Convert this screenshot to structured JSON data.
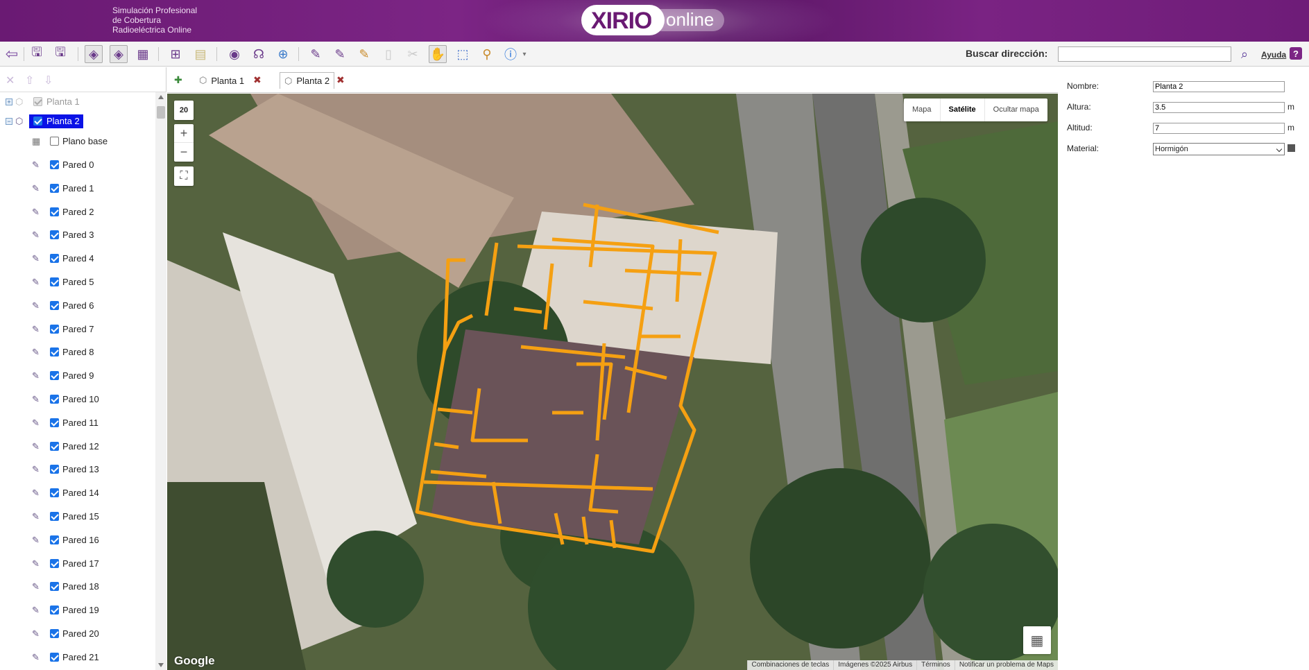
{
  "header": {
    "tagline": [
      "Simulación Profesional",
      "de Cobertura",
      "Radioeléctrica Online"
    ],
    "logo_main": "XIRIO",
    "logo_sub": "online"
  },
  "toolbar": {
    "search_label": "Buscar dirección:",
    "search_value": "",
    "help_label": "Ayuda",
    "help_icon": "?"
  },
  "tabs": [
    {
      "label": "Planta 1",
      "active": false
    },
    {
      "label": "Planta 2",
      "active": true
    }
  ],
  "tree": {
    "plantas": [
      {
        "label": "Planta 1",
        "checked": true,
        "enabled": false,
        "expanded": false
      },
      {
        "label": "Planta 2",
        "checked": true,
        "enabled": true,
        "expanded": true,
        "selected": true
      }
    ],
    "base": {
      "label": "Plano base",
      "checked": false
    },
    "walls": [
      "Pared 0",
      "Pared 1",
      "Pared 2",
      "Pared 3",
      "Pared 4",
      "Pared 5",
      "Pared 6",
      "Pared 7",
      "Pared 8",
      "Pared 9",
      "Pared 10",
      "Pared 11",
      "Pared 12",
      "Pared 13",
      "Pared 14",
      "Pared 15",
      "Pared 16",
      "Pared 17",
      "Pared 18",
      "Pared 19",
      "Pared 20",
      "Pared 21"
    ]
  },
  "map": {
    "zoom": "20",
    "types": [
      "Mapa",
      "Satélite",
      "Ocultar mapa"
    ],
    "active_type": "Satélite",
    "google": "Google",
    "attribution": [
      "Combinaciones de teclas",
      "Imágenes ©2025 Airbus",
      "Términos",
      "Notificar un problema de Maps"
    ],
    "floorplan_color": "#f5a012"
  },
  "properties": {
    "nombre_label": "Nombre:",
    "nombre_value": "Planta 2",
    "altura_label": "Altura:",
    "altura_value": "3.5",
    "altura_unit": "m",
    "altitud_label": "Altitud:",
    "altitud_value": "7",
    "altitud_unit": "m",
    "material_label": "Material:",
    "material_value": "Hormigón"
  }
}
